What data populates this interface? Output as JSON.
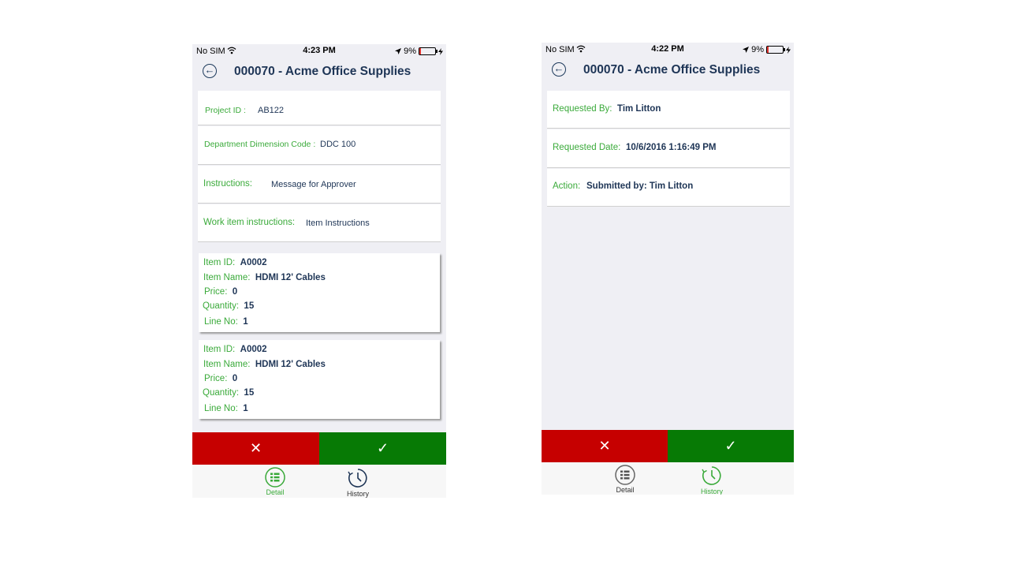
{
  "left_screen": {
    "status": {
      "carrier": "No SIM",
      "time": "4:23 PM",
      "battery": "9%",
      "battery_level": 0.09
    },
    "title": "000070 - Acme Office Supplies",
    "fields": [
      {
        "label": "Project ID :",
        "value": "AB122"
      },
      {
        "label": "Department Dimension Code :",
        "value": "DDC 100"
      },
      {
        "label": "Instructions:",
        "value": "Message for Approver"
      },
      {
        "label": "Work item instructions:",
        "value": "Item Instructions"
      }
    ],
    "items": [
      {
        "id_label": "Item ID:",
        "id": "A0002",
        "name_label": "Item Name:",
        "name": "HDMI 12' Cables",
        "price_label": "Price:",
        "price": "0",
        "qty_label": "Quantity:",
        "qty": "15",
        "line_label": "Line No:",
        "line": "1"
      },
      {
        "id_label": "Item ID:",
        "id": "A0002",
        "name_label": "Item Name:",
        "name": "HDMI 12' Cables",
        "price_label": "Price:",
        "price": "0",
        "qty_label": "Quantity:",
        "qty": "15",
        "line_label": "Line No:",
        "line": "1"
      }
    ],
    "reject_icon": "✕",
    "approve_icon": "✓",
    "tabs": [
      {
        "label": "Detail",
        "active": true
      },
      {
        "label": "History",
        "active": false
      }
    ]
  },
  "right_screen": {
    "status": {
      "carrier": "No SIM",
      "time": "4:22 PM",
      "battery": "9%",
      "battery_level": 0.09
    },
    "title": "000070 - Acme Office Supplies",
    "fields": [
      {
        "label": "Requested By:",
        "value": "Tim Litton"
      },
      {
        "label": "Requested Date:",
        "value": "10/6/2016 1:16:49 PM"
      },
      {
        "label": "Action:",
        "value": "Submitted by: Tim Litton"
      }
    ],
    "reject_icon": "✕",
    "approve_icon": "✓",
    "tabs": [
      {
        "label": "Detail",
        "active": false
      },
      {
        "label": "History",
        "active": true
      }
    ]
  },
  "colors": {
    "label_green": "#3aaa3a",
    "value_navy": "#1e3556",
    "reject_red": "#c60000",
    "approve_green": "#077a05",
    "tab_inactive": "#333333"
  },
  "icons": {
    "back": "back-arrow-icon",
    "wifi": "wifi-icon",
    "location": "location-arrow-icon",
    "detail": "list-icon",
    "history": "clock-icon"
  }
}
